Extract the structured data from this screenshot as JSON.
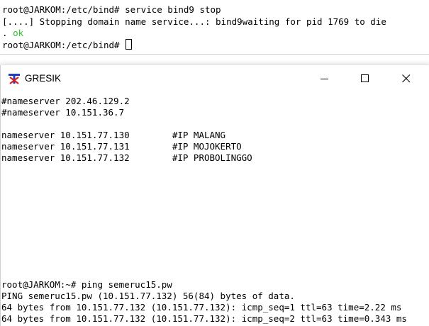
{
  "bg_terminal": {
    "line1": "root@JARKOM:/etc/bind# service bind9 stop",
    "line2": "[....] Stopping domain name service...: bind9waiting for pid 1769 to die",
    "line3_prefix": ". ",
    "line3_ok": "ok",
    "line4": "root@JARKOM:/etc/bind# "
  },
  "window": {
    "title": "GRESIK",
    "minimize_label": "",
    "maximize_label": "",
    "close_label": ""
  },
  "terminal": {
    "lines": [
      "#nameserver 202.46.129.2",
      "#nameserver 10.151.36.7",
      "",
      "nameserver 10.151.77.130        #IP MALANG",
      "nameserver 10.151.77.131        #IP MOJOKERTO",
      "nameserver 10.151.77.132        #IP PROBOLINGGO"
    ],
    "ping_lines": [
      "root@JARKOM:~# ping semeruc15.pw",
      "PING semeruc15.pw (10.151.77.132) 56(84) bytes of data.",
      "64 bytes from 10.151.77.132 (10.151.77.132): icmp_seq=1 ttl=63 time=2.22 ms",
      "64 bytes from 10.151.77.132 (10.151.77.132): icmp_seq=2 ttl=63 time=0.343 ms"
    ]
  },
  "colors": {
    "ok_green": "#2fbf2f",
    "icon_blue": "#1f3fbf",
    "icon_red": "#d82020"
  }
}
